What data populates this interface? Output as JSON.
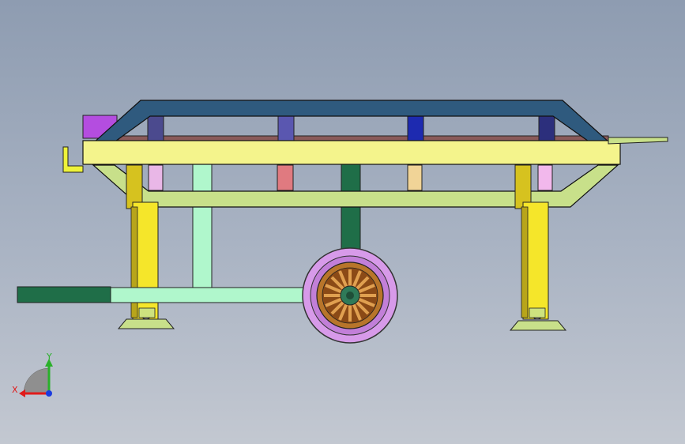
{
  "viewport": {
    "background_top": "#8e9cb1",
    "background_bottom": "#c3c8d1"
  },
  "model": {
    "parts": {
      "top_frame_color": "#2f5a7e",
      "yellow_rail_color": "#f4f48c",
      "lower_rail_color": "#c8e08a",
      "post_color": "#f5e62a",
      "drawbar_green": "#1f6e48",
      "drawbar_mint": "#b0f7cc",
      "center_post_green": "#1f6e48",
      "tire_color": "#d79ae9",
      "rim_color": "#b8752a",
      "bracket_magenta": "#b44de0",
      "stub_colors": [
        "#e9b7e7",
        "#e07a80",
        "#f1d497",
        "#f2b8ec"
      ],
      "cross_member_colors": [
        "#4b4a8e",
        "#5a57b0",
        "#1d2ab0",
        "#2c2f7c"
      ]
    }
  },
  "triad": {
    "x_label": "X",
    "y_label": "Y",
    "x_color": "#e01b1b",
    "y_color": "#2ab02a",
    "z_color": "#1b3be0"
  }
}
